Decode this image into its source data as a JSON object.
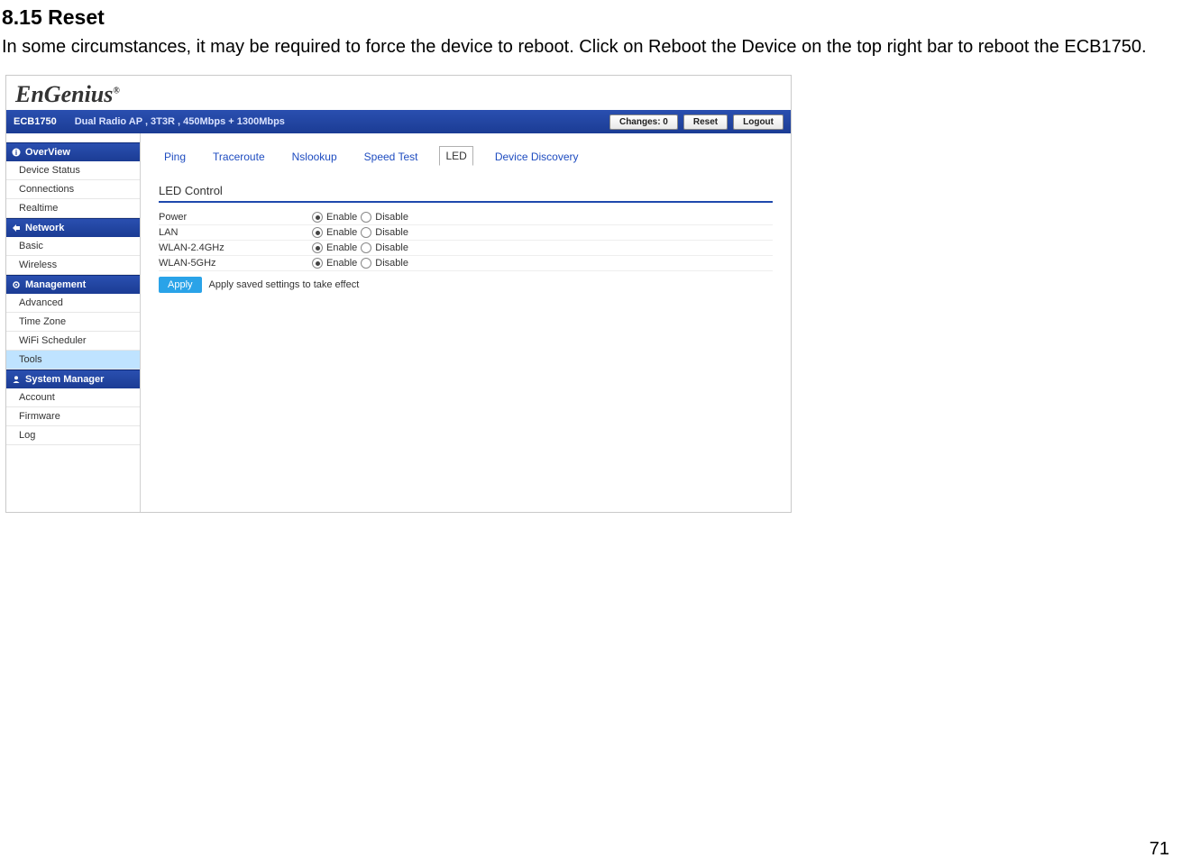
{
  "doc": {
    "heading": "8.15 Reset",
    "paragraph": "In some circumstances, it may be required to force the device to reboot. Click on Reboot the Device on the top right bar to reboot the ECB1750.",
    "page_number": "71"
  },
  "screenshot": {
    "logo": "EnGenius",
    "logo_reg": "®",
    "topbar": {
      "model": "ECB1750",
      "desc": "Dual Radio AP , 3T3R , 450Mbps + 1300Mbps",
      "changes_btn": "Changes: 0",
      "reset_btn": "Reset",
      "logout_btn": "Logout"
    },
    "sidebar": {
      "overview": {
        "header": "OverView",
        "items": [
          "Device Status",
          "Connections",
          "Realtime"
        ]
      },
      "network": {
        "header": "Network",
        "items": [
          "Basic",
          "Wireless"
        ]
      },
      "management": {
        "header": "Management",
        "items": [
          "Advanced",
          "Time Zone",
          "WiFi Scheduler",
          "Tools"
        ]
      },
      "system": {
        "header": "System Manager",
        "items": [
          "Account",
          "Firmware",
          "Log"
        ]
      }
    },
    "tabs": [
      "Ping",
      "Traceroute",
      "Nslookup",
      "Speed Test",
      "LED",
      "Device Discovery"
    ],
    "active_tab": "LED",
    "panel": {
      "title": "LED Control",
      "rows": [
        {
          "label": "Power",
          "enable": "Enable",
          "disable": "Disable"
        },
        {
          "label": "LAN",
          "enable": "Enable",
          "disable": "Disable"
        },
        {
          "label": "WLAN-2.4GHz",
          "enable": "Enable",
          "disable": "Disable"
        },
        {
          "label": "WLAN-5GHz",
          "enable": "Enable",
          "disable": "Disable"
        }
      ],
      "apply_btn": "Apply",
      "apply_text": "Apply saved settings to take effect"
    }
  }
}
